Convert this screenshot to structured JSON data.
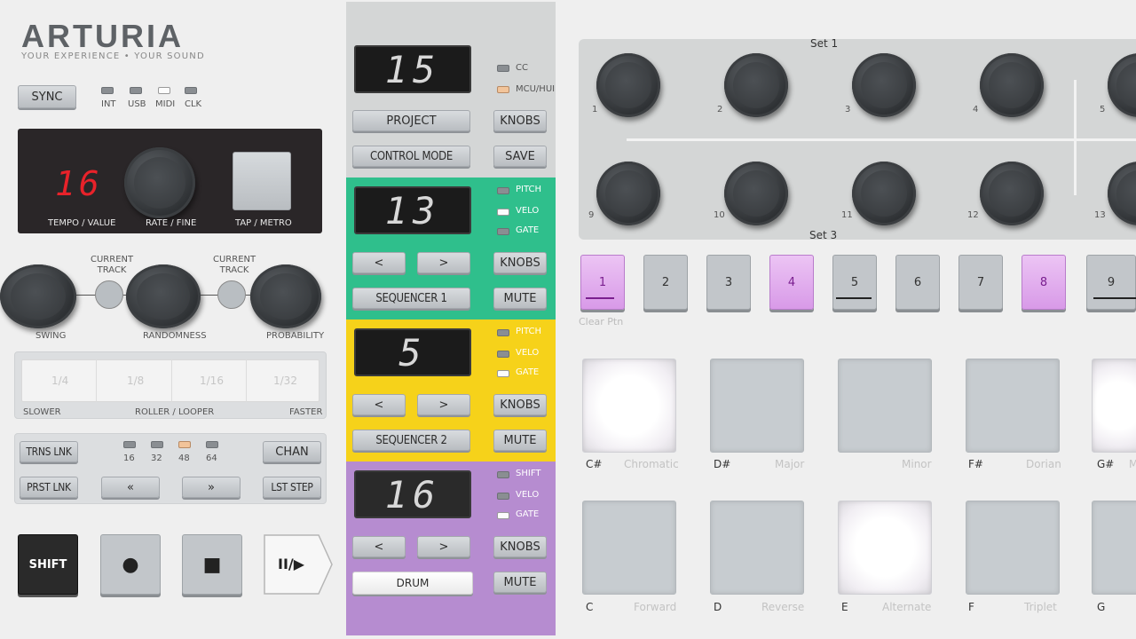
{
  "brand": {
    "name": "ARTURIA",
    "tagline": "YOUR EXPERIENCE • YOUR SOUND"
  },
  "sync": {
    "label": "SYNC",
    "leds": [
      "INT",
      "USB",
      "MIDI",
      "CLK"
    ]
  },
  "tempo": {
    "display": "16",
    "tempo_label": "TEMPO / VALUE",
    "rate_label": "RATE / FINE",
    "tap_label": "TAP / METRO"
  },
  "knobs_row": {
    "swing": "SWING",
    "current_track_1": "CURRENT\nTRACK",
    "randomness": "RANDOMNESS",
    "current_track_2": "CURRENT\nTRACK",
    "probability": "PROBABILITY"
  },
  "roller": {
    "divisions": [
      "1/4",
      "1/8",
      "1/16",
      "1/32"
    ],
    "slower": "SLOWER",
    "label": "ROLLER / LOOPER",
    "faster": "FASTER"
  },
  "length": {
    "trns_lnk": "TRNS LNK",
    "prst_lnk": "PRST LNK",
    "chan": "CHAN",
    "lst_step": "LST STEP",
    "prev": "«",
    "next": "»",
    "steps": [
      "16",
      "32",
      "48",
      "64"
    ]
  },
  "transport": {
    "shift": "SHIFT",
    "record": "●",
    "stop": "■",
    "play": "II/▶"
  },
  "project": {
    "display": "15",
    "project_label": "PROJECT",
    "control_mode_label": "CONTROL MODE",
    "knobs_label": "KNOBS",
    "save_label": "SAVE",
    "leds": [
      "CC",
      "MCU/HUI"
    ]
  },
  "seq1": {
    "display": "13",
    "prev": "<",
    "next": ">",
    "knobs_label": "KNOBS",
    "name": "SEQUENCER 1",
    "mute_label": "MUTE",
    "leds": [
      "PITCH",
      "VELO",
      "GATE"
    ],
    "color": "#2fbf8c"
  },
  "seq2": {
    "display": "5",
    "prev": "<",
    "next": ">",
    "knobs_label": "KNOBS",
    "name": "SEQUENCER 2",
    "mute_label": "MUTE",
    "leds": [
      "PITCH",
      "VELO",
      "GATE"
    ],
    "color": "#f6d21a"
  },
  "drum": {
    "display": "16",
    "prev": "<",
    "next": ">",
    "knobs_label": "KNOBS",
    "name": "DRUM",
    "mute_label": "MUTE",
    "leds": [
      "SHIFT",
      "VELO",
      "GATE"
    ],
    "color": "#b68cd0"
  },
  "encoders": {
    "set1": "Set 1",
    "set3": "Set 3",
    "top": [
      "1",
      "2",
      "3",
      "4",
      "5"
    ],
    "bottom": [
      "9",
      "10",
      "11",
      "12",
      "13"
    ]
  },
  "steps": {
    "labels": [
      "1",
      "2",
      "3",
      "4",
      "5",
      "6",
      "7",
      "8",
      "9"
    ],
    "clear": "Clear Ptn"
  },
  "pads_row1": [
    {
      "note": "C#",
      "scale": "Chromatic"
    },
    {
      "note": "D#",
      "scale": "Major"
    },
    {
      "note": "",
      "scale": "Minor"
    },
    {
      "note": "F#",
      "scale": "Dorian"
    },
    {
      "note": "G#",
      "scale": "M"
    }
  ],
  "pads_row2": [
    {
      "note": "C",
      "mode": "Forward"
    },
    {
      "note": "D",
      "mode": "Reverse"
    },
    {
      "note": "E",
      "mode": "Alternate"
    },
    {
      "note": "F",
      "mode": "Triplet"
    },
    {
      "note": "G",
      "mode": ""
    }
  ]
}
